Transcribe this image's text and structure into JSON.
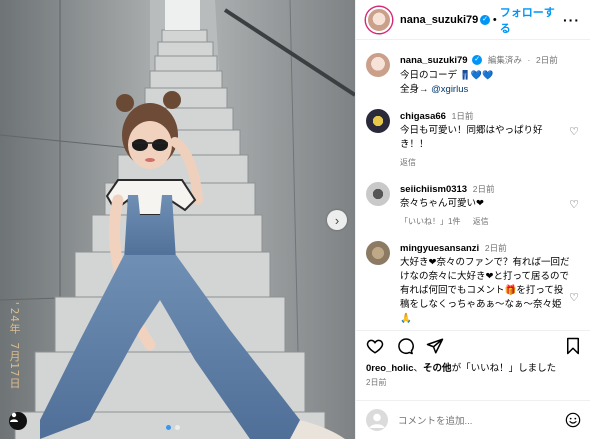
{
  "photo": {
    "date_stamp": "'24年 7月17日",
    "dots": [
      true,
      false
    ],
    "next_icon": "chevron-right-icon"
  },
  "header": {
    "username": "nana_suzuki79",
    "dot": "•",
    "follow_label": "フォローする",
    "more_icon": "more-horizontal-icon"
  },
  "caption": {
    "username": "nana_suzuki79",
    "edited": "編集済み",
    "time": "2日前",
    "line1": "今日のコーデ",
    "line1_emoji": "👖💙💙",
    "line2_prefix": "全身→ ",
    "line2_link": "@xgirlus"
  },
  "comments": [
    {
      "user": "chigasa66",
      "time": "1日前",
      "text": "今日も可愛い！同郷はやっぱり好き！！",
      "reply": "返信",
      "likes": ""
    },
    {
      "user": "seiichiism0313",
      "time": "2日前",
      "text": "奈々ちゃん可愛い❤",
      "likes": "「いいね！」1件",
      "reply": "返信"
    },
    {
      "user": "mingyuesansanzi",
      "time": "2日前",
      "text": "大好き❤奈々のファンで？有れば一回だけなの奈々に大好き❤と打って居るので有れば何回でもコメント🎁を打って投稿をしなくっちゃあぁ〜なぁ〜奈々姫🙏",
      "reply": "",
      "likes": ""
    }
  ],
  "likes": {
    "user": "0reo_holic",
    "joiner": "、",
    "others": "その他",
    "suffix": "が「いいね！」しました"
  },
  "ago": "2日前",
  "add_comment": {
    "placeholder": "コメントを追加..."
  },
  "colors": {
    "accent": "#0095f6",
    "muted": "#737373",
    "story_ring": "#d62976"
  }
}
